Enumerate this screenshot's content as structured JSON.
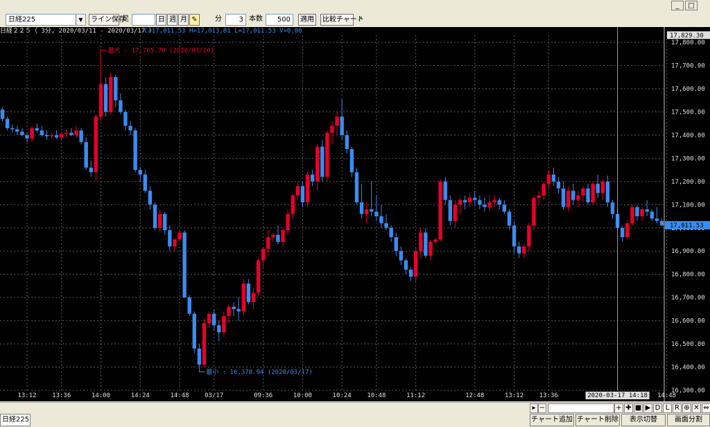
{
  "toolbar": {
    "symbol": "日経225",
    "line_save": "ライン保存",
    "fixed": "足",
    "day": "日",
    "week": "週",
    "month": "月",
    "minute": "分",
    "minute_value": "3",
    "count_label": "本数",
    "count_value": "500",
    "apply": "適用",
    "compare_chart": "比較チャート"
  },
  "info": {
    "title": "日経２２５（ 3分, 2020/03/11 - 2020/03/17 ）",
    "ohlc": "C=17,011.53 H=17,013.81 L=17,011.53 V=0.00"
  },
  "annotations": {
    "max": "最大 : 17,765.78 (2020/03/16)",
    "min": "最小 : 16,378.94 (2020/03/17)"
  },
  "cursor": {
    "x_label": "2020-03-17  14:18",
    "y_label": "17,829.30"
  },
  "last_price": "17,011.53",
  "bottom": {
    "tab": "日経225",
    "add_chart": "チャート追加",
    "remove_chart": "チャート削除",
    "toggle_view": "表示切替",
    "split_screen": "画面分割"
  },
  "scroll_buttons": [
    "+",
    "✚",
    "■",
    "▶",
    "D",
    "L",
    "R",
    "⊕",
    "✕",
    "⇔"
  ],
  "colors": {
    "up": "#e8002a",
    "down": "#3a8cf0",
    "grid": "#5a5a5a",
    "axis_text": "#e0e0e0",
    "max_text": "#e8002a",
    "min_text": "#3a8cf0",
    "last_price_bg": "#3a8cf0"
  },
  "chart_data": {
    "type": "candlestick",
    "ylim": [
      16300,
      17830
    ],
    "y_ticks": [
      "17,800.00",
      "17,700.00",
      "17,600.00",
      "17,500.00",
      "17,400.00",
      "17,300.00",
      "17,200.00",
      "17,100.00",
      "17,000.00",
      "16,900.00",
      "16,800.00",
      "16,700.00",
      "16,600.00",
      "16,500.00",
      "16,400.00",
      "16,300.00"
    ],
    "x_labels": [
      {
        "label": "13:12",
        "index": 5
      },
      {
        "label": "13:36",
        "index": 12
      },
      {
        "label": "14:00",
        "index": 20
      },
      {
        "label": "14:24",
        "index": 28
      },
      {
        "label": "14:48",
        "index": 36
      },
      {
        "label": "03/17",
        "index": 43
      },
      {
        "label": "09:36",
        "index": 53
      },
      {
        "label": "10:00",
        "index": 61
      },
      {
        "label": "10:24",
        "index": 69
      },
      {
        "label": "10:48",
        "index": 76
      },
      {
        "label": "11:12",
        "index": 84
      },
      {
        "label": "12:48",
        "index": 96
      },
      {
        "label": "13:12",
        "index": 104
      },
      {
        "label": "13:36",
        "index": 111
      },
      {
        "label": "14:18",
        "index": 125
      },
      {
        "label": "14:48",
        "index": 135
      }
    ],
    "candles": [
      [
        17510,
        17520,
        17460,
        17470
      ],
      [
        17470,
        17480,
        17420,
        17430
      ],
      [
        17430,
        17445,
        17410,
        17425
      ],
      [
        17425,
        17440,
        17400,
        17415
      ],
      [
        17415,
        17430,
        17395,
        17400
      ],
      [
        17400,
        17410,
        17370,
        17385
      ],
      [
        17385,
        17440,
        17370,
        17430
      ],
      [
        17430,
        17450,
        17410,
        17420
      ],
      [
        17420,
        17440,
        17395,
        17400
      ],
      [
        17400,
        17420,
        17380,
        17395
      ],
      [
        17395,
        17410,
        17385,
        17400
      ],
      [
        17400,
        17420,
        17385,
        17390
      ],
      [
        17390,
        17415,
        17380,
        17405
      ],
      [
        17405,
        17425,
        17390,
        17410
      ],
      [
        17410,
        17430,
        17395,
        17400
      ],
      [
        17400,
        17440,
        17390,
        17420
      ],
      [
        17420,
        17430,
        17360,
        17370
      ],
      [
        17370,
        17390,
        17250,
        17260
      ],
      [
        17260,
        17290,
        17220,
        17240
      ],
      [
        17240,
        17490,
        17200,
        17480
      ],
      [
        17480,
        17766,
        17460,
        17620
      ],
      [
        17620,
        17650,
        17480,
        17500
      ],
      [
        17500,
        17670,
        17490,
        17650
      ],
      [
        17650,
        17660,
        17520,
        17550
      ],
      [
        17550,
        17580,
        17490,
        17500
      ],
      [
        17500,
        17510,
        17420,
        17440
      ],
      [
        17440,
        17460,
        17400,
        17420
      ],
      [
        17420,
        17430,
        17240,
        17250
      ],
      [
        17250,
        17260,
        17200,
        17230
      ],
      [
        17230,
        17250,
        17150,
        17160
      ],
      [
        17160,
        17180,
        17080,
        17100
      ],
      [
        17100,
        17110,
        16990,
        17000
      ],
      [
        17000,
        17080,
        16980,
        17060
      ],
      [
        17060,
        17070,
        16970,
        16990
      ],
      [
        16990,
        17010,
        16900,
        16920
      ],
      [
        16920,
        16960,
        16900,
        16950
      ],
      [
        16950,
        16990,
        16940,
        16980
      ],
      [
        16980,
        16990,
        16770,
        16700
      ],
      [
        16700,
        16710,
        16620,
        16630
      ],
      [
        16630,
        16640,
        16460,
        16480
      ],
      [
        16480,
        16500,
        16379,
        16410
      ],
      [
        16410,
        16610,
        16400,
        16590
      ],
      [
        16590,
        16640,
        16570,
        16630
      ],
      [
        16630,
        16650,
        16560,
        16580
      ],
      [
        16580,
        16600,
        16510,
        16550
      ],
      [
        16550,
        16640,
        16530,
        16620
      ],
      [
        16620,
        16670,
        16590,
        16660
      ],
      [
        16660,
        16680,
        16620,
        16650
      ],
      [
        16650,
        16700,
        16600,
        16640
      ],
      [
        16640,
        16780,
        16620,
        16760
      ],
      [
        16760,
        16780,
        16670,
        16680
      ],
      [
        16680,
        16740,
        16650,
        16720
      ],
      [
        16720,
        16870,
        16710,
        16860
      ],
      [
        16860,
        16920,
        16830,
        16910
      ],
      [
        16910,
        16990,
        16880,
        16960
      ],
      [
        16960,
        16980,
        16940,
        16970
      ],
      [
        16970,
        17010,
        16930,
        16940
      ],
      [
        16940,
        17000,
        16920,
        16990
      ],
      [
        16990,
        17080,
        16970,
        17060
      ],
      [
        17060,
        17150,
        17040,
        17140
      ],
      [
        17140,
        17200,
        17120,
        17180
      ],
      [
        17180,
        17200,
        17090,
        17110
      ],
      [
        17110,
        17240,
        17090,
        17230
      ],
      [
        17230,
        17250,
        17180,
        17200
      ],
      [
        17200,
        17360,
        17160,
        17350
      ],
      [
        17350,
        17380,
        17200,
        17220
      ],
      [
        17220,
        17420,
        17200,
        17410
      ],
      [
        17410,
        17460,
        17360,
        17440
      ],
      [
        17440,
        17500,
        17400,
        17480
      ],
      [
        17480,
        17555,
        17380,
        17400
      ],
      [
        17400,
        17420,
        17320,
        17340
      ],
      [
        17340,
        17350,
        17220,
        17240
      ],
      [
        17240,
        17260,
        17100,
        17110
      ],
      [
        17110,
        17190,
        17040,
        17060
      ],
      [
        17060,
        17110,
        17020,
        17080
      ],
      [
        17080,
        17200,
        17050,
        17070
      ],
      [
        17070,
        17140,
        17030,
        17050
      ],
      [
        17050,
        17100,
        17000,
        17020
      ],
      [
        17020,
        17060,
        16990,
        17000
      ],
      [
        17000,
        17010,
        16940,
        16960
      ],
      [
        16960,
        16980,
        16880,
        16900
      ],
      [
        16900,
        16920,
        16840,
        16860
      ],
      [
        16860,
        16870,
        16800,
        16820
      ],
      [
        16820,
        16830,
        16770,
        16790
      ],
      [
        16790,
        16920,
        16770,
        16900
      ],
      [
        16900,
        17000,
        16870,
        16980
      ],
      [
        16980,
        17000,
        16870,
        16880
      ],
      [
        16880,
        16950,
        16860,
        16940
      ],
      [
        16940,
        16960,
        16930,
        16950
      ],
      [
        16950,
        17210,
        16940,
        17200
      ],
      [
        17200,
        17220,
        17100,
        17120
      ],
      [
        17120,
        17140,
        17010,
        17030
      ],
      [
        17030,
        17120,
        17000,
        17100
      ],
      [
        17100,
        17130,
        17060,
        17120
      ],
      [
        17120,
        17140,
        17080,
        17110
      ],
      [
        17110,
        17150,
        17090,
        17130
      ],
      [
        17130,
        17160,
        17100,
        17120
      ],
      [
        17120,
        17140,
        17080,
        17100
      ],
      [
        17100,
        17130,
        17070,
        17090
      ],
      [
        17090,
        17140,
        17070,
        17110
      ],
      [
        17110,
        17140,
        17090,
        17120
      ],
      [
        17120,
        17130,
        17080,
        17100
      ],
      [
        17100,
        17120,
        17060,
        17070
      ],
      [
        17070,
        17080,
        16990,
        17010
      ],
      [
        17010,
        17030,
        16890,
        16920
      ],
      [
        16920,
        16940,
        16870,
        16890
      ],
      [
        16890,
        16930,
        16870,
        16920
      ],
      [
        16920,
        17020,
        16900,
        17010
      ],
      [
        17010,
        17140,
        16990,
        17130
      ],
      [
        17130,
        17160,
        17100,
        17140
      ],
      [
        17140,
        17200,
        17120,
        17190
      ],
      [
        17190,
        17250,
        17170,
        17230
      ],
      [
        17230,
        17260,
        17180,
        17200
      ],
      [
        17200,
        17220,
        17150,
        17170
      ],
      [
        17170,
        17200,
        17080,
        17090
      ],
      [
        17090,
        17180,
        17070,
        17160
      ],
      [
        17160,
        17190,
        17100,
        17120
      ],
      [
        17120,
        17160,
        17090,
        17140
      ],
      [
        17140,
        17180,
        17110,
        17170
      ],
      [
        17170,
        17190,
        17100,
        17110
      ],
      [
        17110,
        17200,
        17100,
        17190
      ],
      [
        17190,
        17230,
        17130,
        17150
      ],
      [
        17150,
        17210,
        17120,
        17200
      ],
      [
        17200,
        17225,
        17090,
        17110
      ],
      [
        17110,
        17120,
        17040,
        17060
      ],
      [
        17060,
        17080,
        16980,
        17000
      ],
      [
        17000,
        17010,
        16940,
        16960
      ],
      [
        16960,
        17030,
        16950,
        17020
      ],
      [
        17020,
        17100,
        17010,
        17090
      ],
      [
        17090,
        17100,
        17030,
        17050
      ],
      [
        17050,
        17090,
        17030,
        17080
      ],
      [
        17080,
        17120,
        17050,
        17070
      ],
      [
        17070,
        17080,
        17030,
        17040
      ],
      [
        17040,
        17090,
        17020,
        17030
      ],
      [
        17030,
        17040,
        17008,
        17011.53
      ]
    ]
  }
}
